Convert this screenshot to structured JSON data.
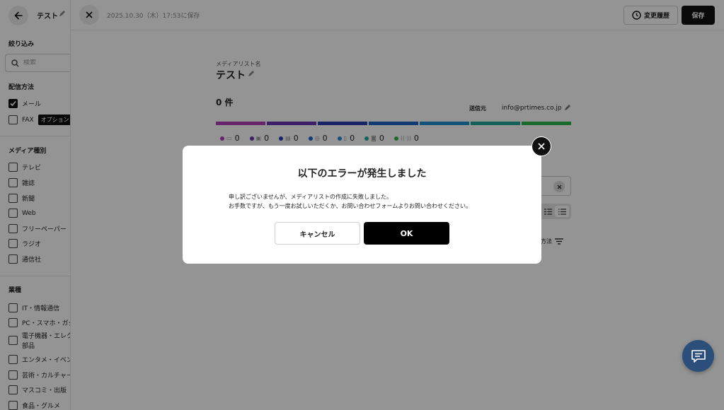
{
  "sidebar": {
    "list_title": "テスト",
    "filter_heading": "絞り込み",
    "search_placeholder": "検索",
    "delivery_heading": "配信方法",
    "delivery_options": [
      {
        "label": "メール",
        "checked": true
      },
      {
        "label": "FAX",
        "checked": false,
        "badge": "オプション"
      }
    ],
    "media_type_heading": "メディア種別",
    "media_types": [
      "テレビ",
      "雑誌",
      "新聞",
      "Web",
      "フリーペーパー",
      "ラジオ",
      "通信社"
    ],
    "industry_heading": "業種",
    "industries": [
      "IT・情報通信",
      "PC・スマホ・ガジェ",
      "電子機器・エレク",
      "部品",
      "エンタメ・イベン",
      "芸術・カルチャー",
      "マスコミ・出版",
      "食品・グルメ"
    ]
  },
  "header": {
    "saved_at": "2025.10.30（木）17:53に保存",
    "history_label": "変更履歴",
    "save_label": "保存"
  },
  "main": {
    "list_name_label": "メディアリスト名",
    "list_name": "テスト",
    "count": "0 件",
    "sender_label": "送信元",
    "sender_value": "info@prtimes.co.jp",
    "media_counts": [
      {
        "icon": "tv-icon",
        "glyph": "▭",
        "value": "0",
        "color": "#b13fb5"
      },
      {
        "icon": "magazine-icon",
        "glyph": "▣",
        "value": "0",
        "color": "#6a34b4"
      },
      {
        "icon": "newspaper-icon",
        "glyph": "▤",
        "value": "0",
        "color": "#2a3fb0"
      },
      {
        "icon": "web-icon",
        "glyph": "◎",
        "value": "0",
        "color": "#1e62c4"
      },
      {
        "icon": "freepaper-icon",
        "glyph": "▯",
        "value": "0",
        "color": "#1f8fd0"
      },
      {
        "icon": "radio-icon",
        "glyph": "◙",
        "value": "0",
        "color": "#22a89a"
      },
      {
        "icon": "news-agency-icon",
        "glyph": "((·))",
        "value": "0",
        "color": "#2bb84a"
      }
    ],
    "bar_colors": [
      "#b13fb5",
      "#6a34b4",
      "#2a3fb0",
      "#1e62c4",
      "#1f8fd0",
      "#22a89a",
      "#2bb84a"
    ],
    "sort_label": "方法"
  },
  "modal": {
    "title": "以下のエラーが発生しました",
    "message_line1": "申し訳ございませんが、メディアリストの作成に失敗しました。",
    "message_line2": "お手数ですが、もう一度お試しいただくか、お問い合わせフォームよりお問い合わせください。",
    "cancel_label": "キャンセル",
    "ok_label": "OK"
  }
}
